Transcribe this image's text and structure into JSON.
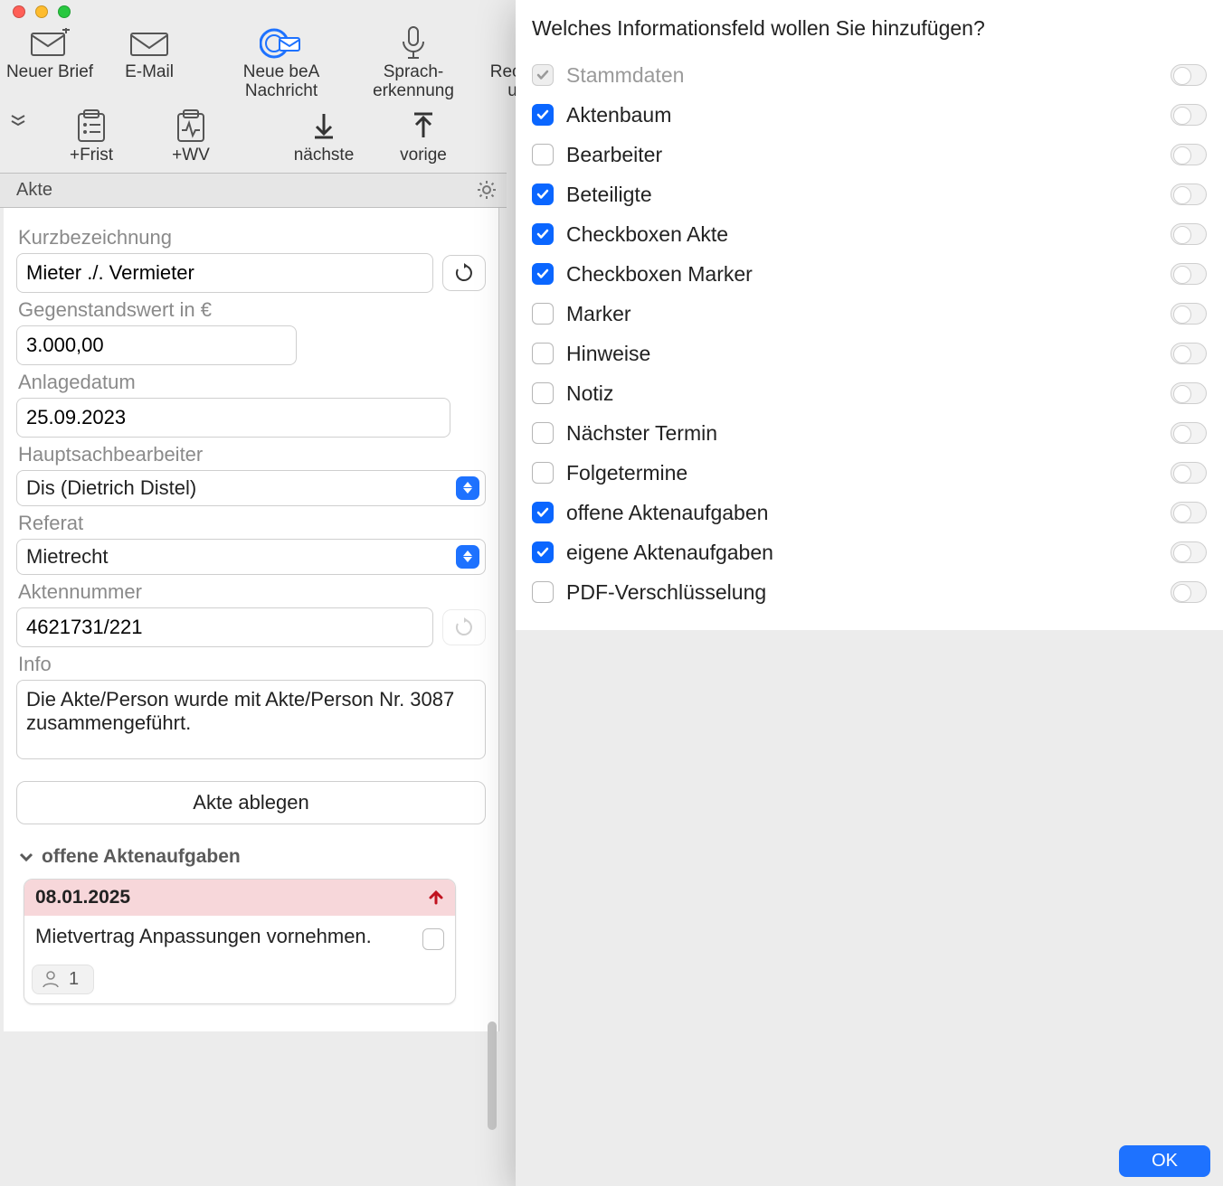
{
  "toolbar1": [
    {
      "label": "Neuer Brief"
    },
    {
      "label": "E-Mail"
    },
    {
      "label": "Neue beA\nNachricht"
    },
    {
      "label": "Sprach-\nerkennung"
    },
    {
      "label": "Rechnung abs\nund verse"
    }
  ],
  "toolbar2": [
    {
      "label": "+Frist"
    },
    {
      "label": "+WV"
    },
    {
      "label": "nächste"
    },
    {
      "label": "vorige"
    }
  ],
  "panel": {
    "title": "Akte"
  },
  "form": {
    "kurz_label": "Kurzbezeichnung",
    "kurz_value": "Mieter ./. Vermieter",
    "wert_label": "Gegenstandswert in €",
    "wert_value": "3.000,00",
    "datum_label": "Anlagedatum",
    "datum_value": "25.09.2023",
    "bearbeiter_label": "Hauptsachbearbeiter",
    "bearbeiter_value": "Dis (Dietrich Distel)",
    "referat_label": "Referat",
    "referat_value": "Mietrecht",
    "nummer_label": "Aktennummer",
    "nummer_value": "4621731/221",
    "info_label": "Info",
    "info_value": "Die Akte/Person wurde mit Akte/Person Nr. 3087 zusammengeführt.",
    "ablegen_label": "Akte ablegen"
  },
  "section": {
    "title": "offene Aktenaufgaben"
  },
  "task": {
    "date": "08.01.2025",
    "text": "Mietvertrag Anpassungen vornehmen.",
    "count": "1"
  },
  "popover": {
    "title": "Welches Informationsfeld wollen Sie hinzufügen?",
    "ok": "OK",
    "options": [
      {
        "label": "Stammdaten",
        "checked": true,
        "disabled": true
      },
      {
        "label": "Aktenbaum",
        "checked": true,
        "disabled": false
      },
      {
        "label": "Bearbeiter",
        "checked": false,
        "disabled": false
      },
      {
        "label": "Beteiligte",
        "checked": true,
        "disabled": false
      },
      {
        "label": "Checkboxen Akte",
        "checked": true,
        "disabled": false
      },
      {
        "label": "Checkboxen Marker",
        "checked": true,
        "disabled": false
      },
      {
        "label": "Marker",
        "checked": false,
        "disabled": false
      },
      {
        "label": "Hinweise",
        "checked": false,
        "disabled": false
      },
      {
        "label": "Notiz",
        "checked": false,
        "disabled": false
      },
      {
        "label": "Nächster Termin",
        "checked": false,
        "disabled": false
      },
      {
        "label": "Folgetermine",
        "checked": false,
        "disabled": false
      },
      {
        "label": "offene Aktenaufgaben",
        "checked": true,
        "disabled": false
      },
      {
        "label": "eigene Aktenaufgaben",
        "checked": true,
        "disabled": false
      },
      {
        "label": "PDF-Verschlüsselung",
        "checked": false,
        "disabled": false
      }
    ]
  }
}
